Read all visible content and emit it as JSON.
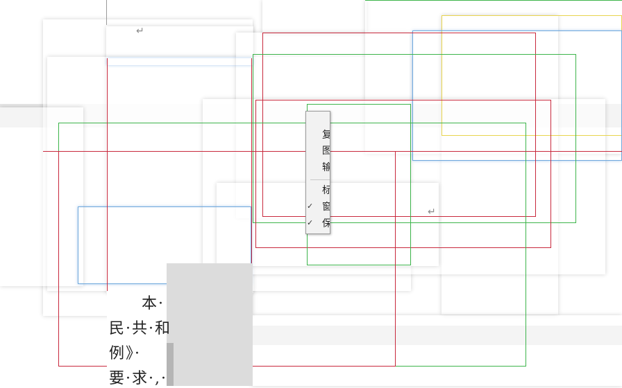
{
  "document": {
    "return_mark": "↵",
    "lines": [
      "本·",
      "民·共·和",
      "例》·",
      "要·求·,·"
    ]
  },
  "context_menu": {
    "items": [
      {
        "label": "复",
        "checked": false
      },
      {
        "label": "图",
        "checked": false
      },
      {
        "label": "输",
        "checked": false
      },
      {
        "label": "标",
        "checked": false
      },
      {
        "label": "窗",
        "checked": true
      },
      {
        "label": "保",
        "checked": true
      }
    ],
    "check_glyph": "✓"
  },
  "colors": {
    "red": "#c8283c",
    "green": "#3cb44a",
    "blue": "#6fa8dc",
    "yellow": "#e8d44d",
    "band": "#e6e6e6"
  }
}
